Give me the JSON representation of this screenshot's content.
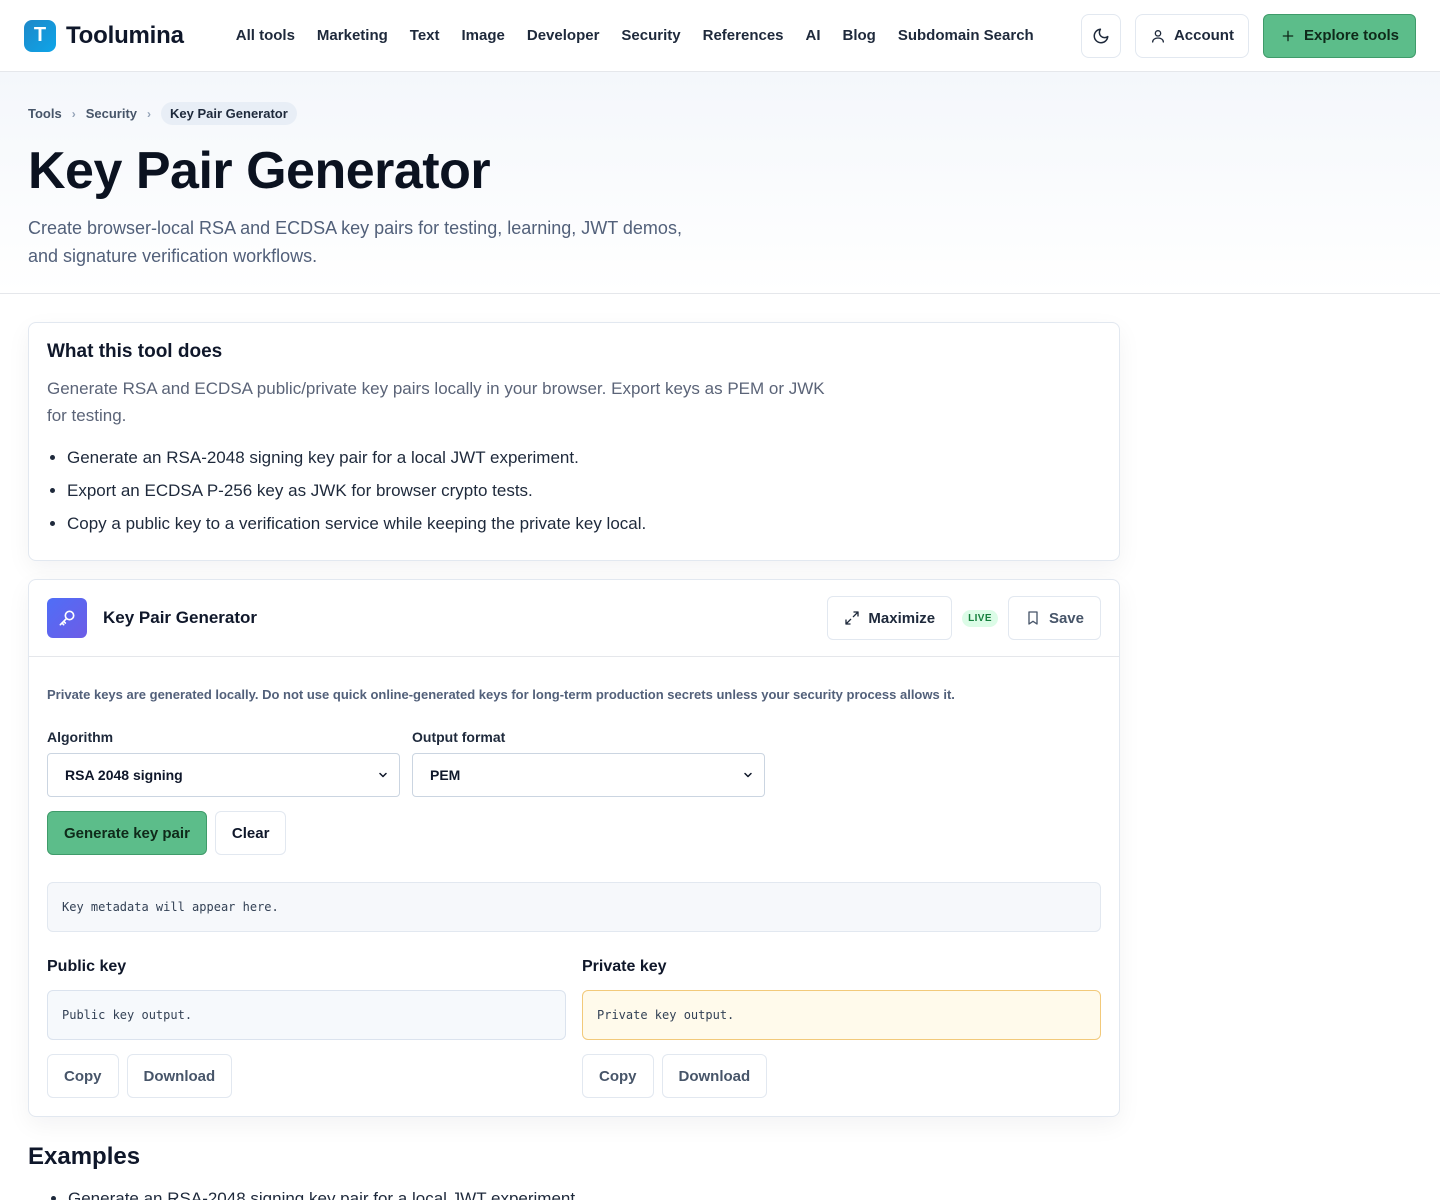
{
  "header": {
    "logo_letter": "T",
    "brand": "Toolumina",
    "nav": [
      "All tools",
      "Marketing",
      "Text",
      "Image",
      "Developer",
      "Security",
      "References",
      "AI",
      "Blog",
      "Subdomain Search"
    ],
    "theme_icon": "moon-icon",
    "account_label": "Account",
    "explore_label": "Explore tools"
  },
  "breadcrumb": {
    "items": [
      "Tools",
      "Security"
    ],
    "current": "Key Pair Generator"
  },
  "hero": {
    "title": "Key Pair Generator",
    "description": "Create browser-local RSA and ECDSA key pairs for testing, learning, JWT demos, and signature verification workflows."
  },
  "about": {
    "heading": "What this tool does",
    "text": "Generate RSA and ECDSA public/private key pairs locally in your browser. Export keys as PEM or JWK for testing.",
    "bullets": [
      "Generate an RSA-2048 signing key pair for a local JWT experiment.",
      "Export an ECDSA P-256 key as JWK for browser crypto tests.",
      "Copy a public key to a verification service while keeping the private key local."
    ]
  },
  "tool": {
    "name": "Key Pair Generator",
    "maximize_label": "Maximize",
    "live_badge": "LIVE",
    "save_label": "Save",
    "notice": "Private keys are generated locally. Do not use quick online-generated keys for long-term production secrets unless your security process allows it.",
    "algorithm_label": "Algorithm",
    "algorithm_value": "RSA 2048 signing",
    "format_label": "Output format",
    "format_value": "PEM",
    "generate_label": "Generate key pair",
    "clear_label": "Clear",
    "metadata_placeholder": "Key metadata will appear here.",
    "public_label": "Public key",
    "public_placeholder": "Public key output.",
    "private_label": "Private key",
    "private_placeholder": "Private key output.",
    "copy_label": "Copy",
    "download_label": "Download"
  },
  "examples": {
    "heading": "Examples",
    "bullets": [
      "Generate an RSA-2048 signing key pair for a local JWT experiment."
    ]
  },
  "colors": {
    "accent_green": "#5cbd8a",
    "live_green": "#15803d",
    "tool_icon": "#4f6ef7",
    "logo": "#1e88c8"
  }
}
